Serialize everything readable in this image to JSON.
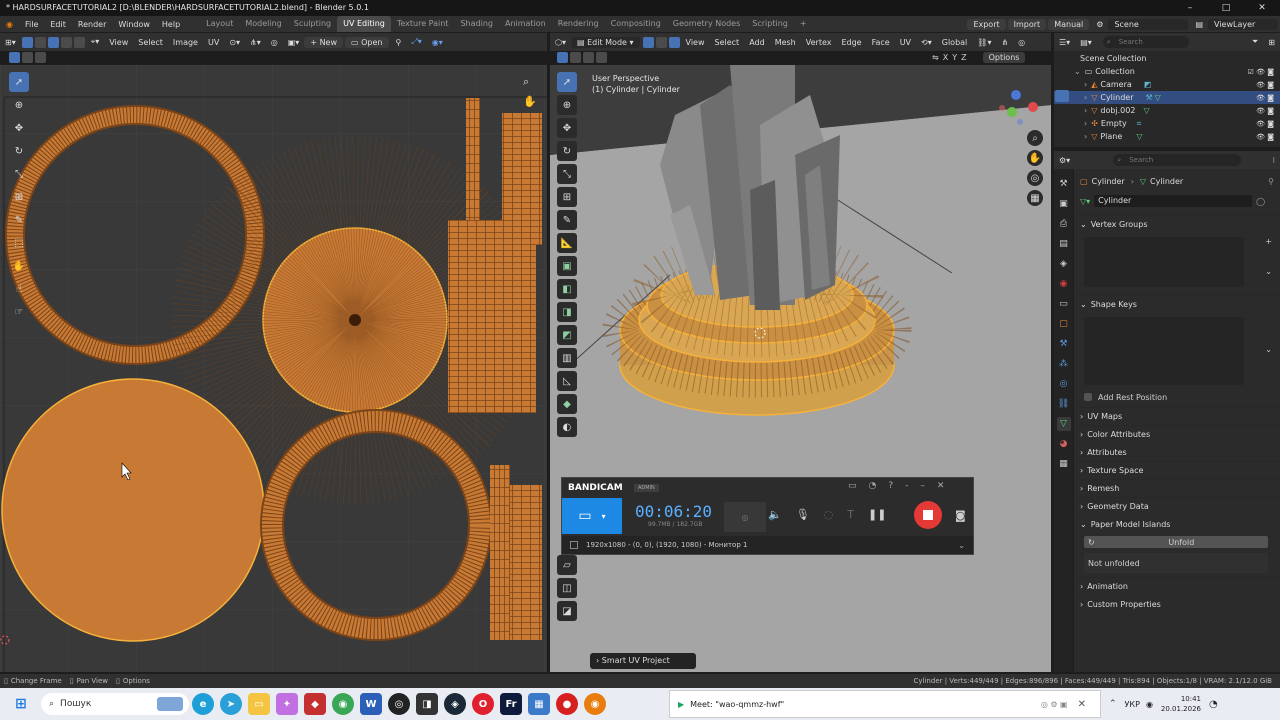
{
  "window": {
    "title": "* HARDSURFACETUTORIAL2 [D:\\BLENDER\\HARDSURFACETUTORIAL2.blend] - Blender 5.0.1",
    "min": "–",
    "max": "□",
    "close": "✕"
  },
  "menus": [
    "File",
    "Edit",
    "Render",
    "Window",
    "Help"
  ],
  "workspaces": [
    "Layout",
    "Modeling",
    "Sculpting",
    "UV Editing",
    "Texture Paint",
    "Shading",
    "Animation",
    "Rendering",
    "Compositing",
    "Geometry Nodes",
    "Scripting"
  ],
  "active_workspace": "UV Editing",
  "add_tab": "+",
  "top_right": {
    "export": "Export",
    "import": "Import",
    "manual": "Manual",
    "scene": "Scene",
    "viewlayer": "ViewLayer"
  },
  "uv_header": {
    "view": "View",
    "select": "Select",
    "image": "Image",
    "uv": "UV",
    "new": "New",
    "open": "Open"
  },
  "vp_header": {
    "mode": "Edit Mode",
    "view": "View",
    "select": "Select",
    "add": "Add",
    "mesh": "Mesh",
    "vertex": "Vertex",
    "edge": "Edge",
    "face": "Face",
    "uv": "UV",
    "orientation": "Global",
    "options": "Options",
    "x": "X",
    "y": "Y",
    "z": "Z"
  },
  "viewport": {
    "perspective": "User Perspective",
    "object": "(1) Cylinder | Cylinder",
    "operator": "Smart UV Project"
  },
  "outliner": {
    "search": "Search",
    "items": [
      {
        "label": "Scene Collection",
        "indent": 0
      },
      {
        "label": "Collection",
        "indent": 1
      },
      {
        "label": "Camera",
        "indent": 2
      },
      {
        "label": "Cylinder",
        "indent": 2
      },
      {
        "label": "dobj.002",
        "indent": 2
      },
      {
        "label": "Empty",
        "indent": 2
      },
      {
        "label": "Plane",
        "indent": 2
      }
    ]
  },
  "properties": {
    "search": "Search",
    "breadcrumb_obj": "Cylinder",
    "breadcrumb_mesh": "Cylinder",
    "mesh_name": "Cylinder",
    "vertex_groups": "Vertex Groups",
    "shape_keys": "Shape Keys",
    "add_rest": "Add Rest Position",
    "panels": [
      "UV Maps",
      "Color Attributes",
      "Attributes",
      "Texture Space",
      "Remesh",
      "Geometry Data"
    ],
    "paper_model": "Paper Model Islands",
    "unfold": "Unfold",
    "not_unfolded": "Not unfolded",
    "animation": "Animation",
    "custom_props": "Custom Properties"
  },
  "bandicam": {
    "brand": "BANDICAM",
    "admin": "ADMIN",
    "timer": "00:06:20",
    "size": "99.7MB / 182.7GB",
    "source": "1920x1080 - (0, 0), (1920, 1080) - Монитор 1"
  },
  "statusbar": {
    "left1": "Change Frame",
    "left2": "Pan View",
    "left3": "Options",
    "right": "Cylinder | Verts:449/449 | Edges:896/896 | Faces:449/449 | Tris:894 | Objects:1/8 | VRAM: 2.1/12.0 GiB"
  },
  "taskbar": {
    "search": "Пошук",
    "meet": "Meet: \"wao-qmmz-hwf\"",
    "lang": "УКР",
    "time": "10:41",
    "date": "20.01.2026"
  },
  "colors": {
    "accent": "#4772b3",
    "uv_orange": "#c87a35",
    "selected_yellow": "#f6b13a"
  }
}
